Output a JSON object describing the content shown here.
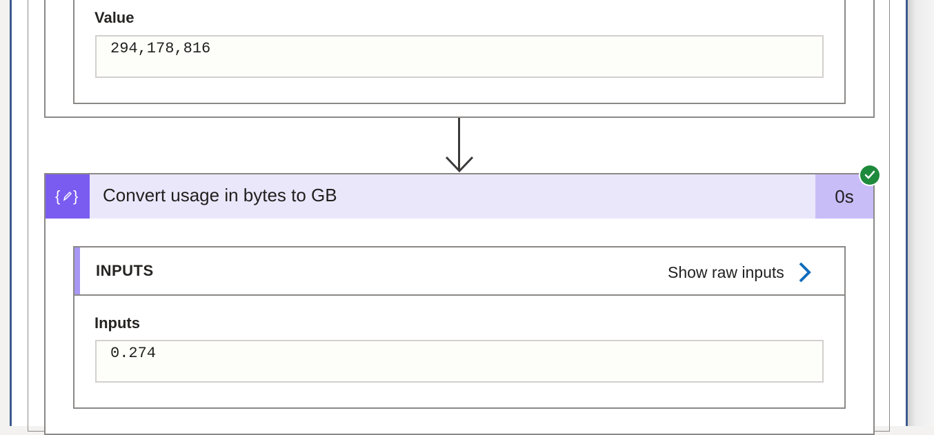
{
  "previous_action": {
    "value_label": "Value",
    "value": "294,178,816"
  },
  "action": {
    "title": "Convert usage in bytes to GB",
    "duration": "0s",
    "icon": "compose-curly-braces-icon",
    "status": "succeeded",
    "accent_color": "#7a5cf0",
    "header_color": "#ebe7fb",
    "duration_color": "#c9bdf8",
    "status_color": "#1e8a3c"
  },
  "inputs": {
    "heading": "INPUTS",
    "show_raw_label": "Show raw inputs",
    "field_label": "Inputs",
    "field_value": "0.274"
  }
}
